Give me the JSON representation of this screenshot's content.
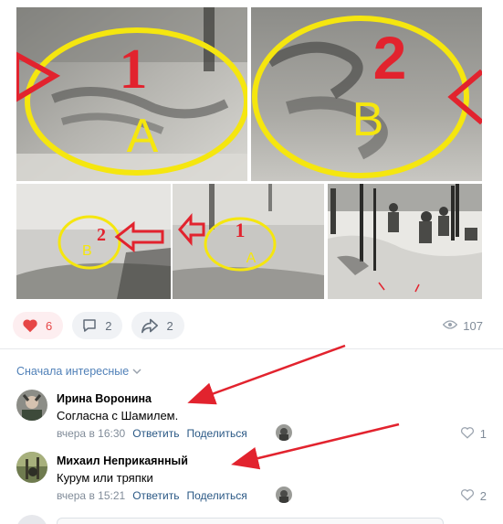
{
  "gallery": {
    "photo1": {
      "number": "1",
      "letter": "A"
    },
    "photo2": {
      "number": "2",
      "letter": "B"
    },
    "photo3": {
      "number": "2",
      "letter": "B"
    },
    "photo4": {
      "number": "1",
      "letter": "A"
    }
  },
  "actions": {
    "likes": "6",
    "comments": "2",
    "shares": "2",
    "views": "107",
    "like_color": "#e64646"
  },
  "comments_section": {
    "sort_label": "Сначала интересные",
    "items": [
      {
        "author": "Ирина Воронина",
        "text": "Согласна с Шамилем.",
        "time": "вчера в 16:30",
        "reply": "Ответить",
        "share": "Поделиться",
        "likes": "1"
      },
      {
        "author": "Михаил Неприкаянный",
        "text": "Курум или тряпки",
        "time": "вчера в 15:21",
        "reply": "Ответить",
        "share": "Поделиться",
        "likes": "2"
      }
    ]
  },
  "colors": {
    "link": "#2a5885",
    "secondary": "#818c99",
    "annotation_yellow": "#f5e60f",
    "annotation_red": "#e2232e"
  }
}
